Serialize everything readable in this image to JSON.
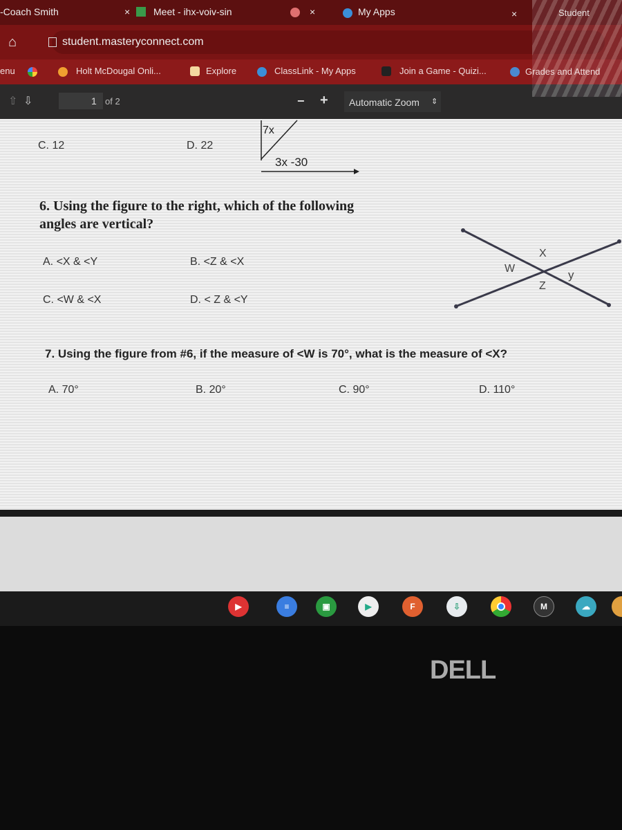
{
  "browser": {
    "tabs": [
      {
        "label": "-Coach Smith",
        "close": "×"
      },
      {
        "label": "Meet - ihx-voiv-sin",
        "close": "×"
      },
      {
        "label": "My Apps",
        "close": "×"
      },
      {
        "label": "Student"
      }
    ],
    "url": "student.masteryconnect.com",
    "bookmarks": [
      "enu",
      "Holt McDougal Onli...",
      "Explore",
      "ClassLink - My Apps",
      "Join a Game - Quizi...",
      "Grades and Attend"
    ]
  },
  "pdf_toolbar": {
    "page_number": "1",
    "page_total": "of 2",
    "zoom_out": "−",
    "zoom_in": "+",
    "zoom": "Automatic Zoom"
  },
  "content": {
    "prev_fig_labels": [
      "7x",
      "3x -30"
    ],
    "prev_choices": [
      "C. 12",
      "D. 22"
    ],
    "q6": {
      "text_line1": "6. Using the figure to the right, which of the following",
      "text_line2": "angles are vertical?",
      "choices": [
        "A. <X & <Y",
        "B. <Z & <X",
        "C. <W & <X",
        "D. < Z & <Y"
      ],
      "figure_labels": {
        "x": "X",
        "w": "W",
        "y": "y",
        "z": "Z"
      }
    },
    "q7": {
      "text": "7. Using the figure from #6, if the measure of <W is 70°, what is the measure of <X?",
      "choices": [
        "A. 70°",
        "B. 20°",
        "C. 90°",
        "D. 110°"
      ]
    }
  },
  "shelf": {
    "apps": [
      "youtube",
      "docs",
      "classroom",
      "play-store",
      "flipgrid",
      "app",
      "chrome",
      "m-app",
      "cloud-app"
    ],
    "m_label": "M"
  },
  "bezel_logo": "DELL"
}
